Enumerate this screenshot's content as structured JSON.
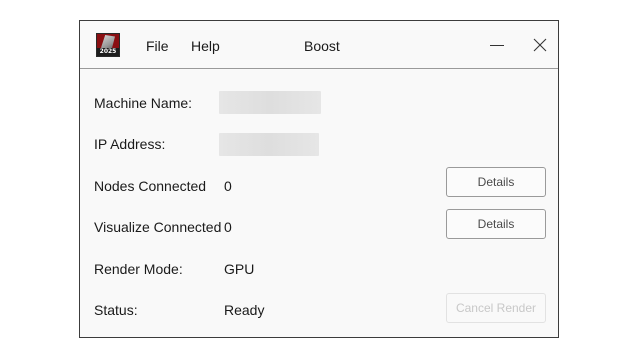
{
  "window": {
    "title": "Boost",
    "logo_year": "2025"
  },
  "menu": {
    "file": "File",
    "help": "Help"
  },
  "fields": {
    "machine_name": {
      "label": "Machine Name:",
      "value": ""
    },
    "ip_address": {
      "label": "IP Address:",
      "value": ""
    },
    "nodes_connected": {
      "label": "Nodes Connected",
      "value": "0"
    },
    "visualize_connected": {
      "label": "Visualize Connected",
      "value": "0"
    },
    "render_mode": {
      "label": "Render Mode:",
      "value": "GPU"
    },
    "status": {
      "label": "Status:",
      "value": "Ready"
    }
  },
  "buttons": {
    "nodes_details": "Details",
    "visualize_details": "Details",
    "cancel_render": "Cancel Render"
  },
  "icons": {
    "app_logo": "app-logo-icon",
    "minimize": "minimize-icon",
    "close": "close-icon"
  },
  "colors": {
    "window_bg": "#f9f9f9",
    "border": "#3c3c3c",
    "logo_red": "#8a0f12",
    "disabled_text": "#c8c8c8"
  }
}
